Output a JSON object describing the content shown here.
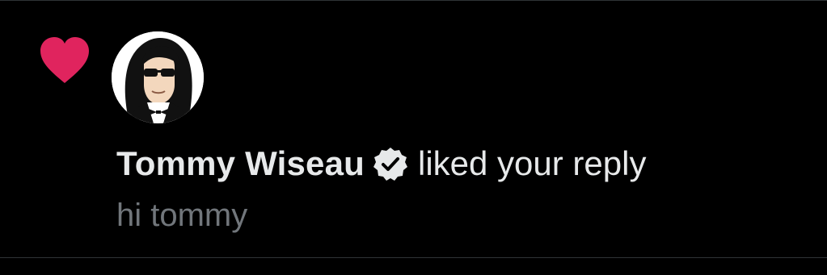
{
  "notification": {
    "user_name": "Tommy Wiseau",
    "action_text": "liked your reply",
    "reply_text": "hi tommy",
    "icon": "heart-icon",
    "badge": "verified-badge-icon"
  },
  "colors": {
    "background": "#000000",
    "heart": "#f91880",
    "primary_text": "#e7e9ea",
    "secondary_text": "#71767b",
    "divider": "#2f3336"
  }
}
